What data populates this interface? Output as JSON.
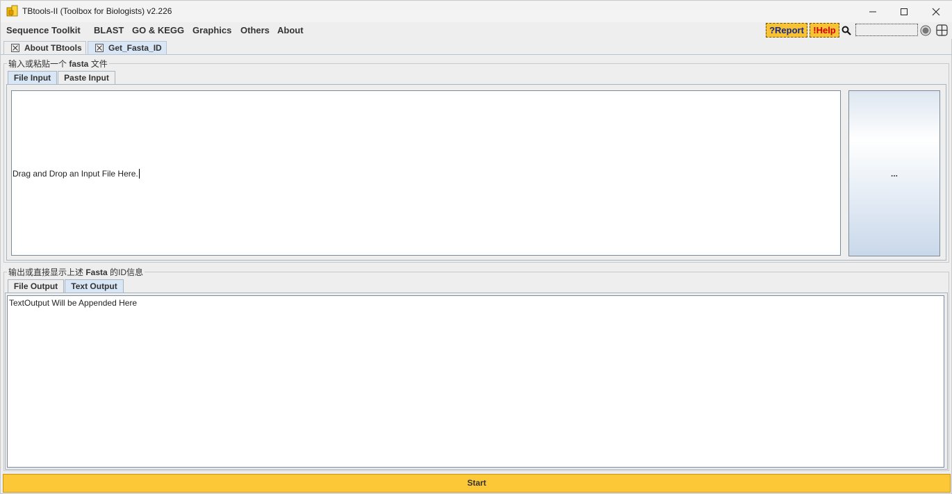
{
  "window": {
    "title": "TBtools-II (Toolbox for Biologists) v2.226"
  },
  "menu": {
    "items": [
      "Sequence Toolkit",
      "BLAST",
      "GO & KEGG",
      "Graphics",
      "Others",
      "About"
    ],
    "report_label": "?Report",
    "help_label": "!Help",
    "search_value": ""
  },
  "tabs": [
    {
      "label": "About TBtools",
      "active": false
    },
    {
      "label": "Get_Fasta_ID",
      "active": true
    }
  ],
  "input_group": {
    "title_prefix": "输入或粘贴一个 ",
    "title_bold": "fasta",
    "title_suffix": " 文件",
    "tabs": [
      "File Input",
      "Paste Input"
    ],
    "active_tab": "File Input",
    "drop_hint": "Drag and Drop an Input File Here.",
    "browse_label": "..."
  },
  "output_group": {
    "title_prefix": "输出或直接显示上述 ",
    "title_bold": "Fasta",
    "title_suffix": " 的ID信息",
    "tabs": [
      "File Output",
      "Text Output"
    ],
    "active_tab": "Text Output",
    "text_output": "TextOutput Will be Appended Here"
  },
  "start_label": "Start",
  "colors": {
    "accent": "#fdc838",
    "help_text": "#d40000",
    "report_text": "#1a2a8a",
    "active_tab": "#d8e6f5"
  }
}
